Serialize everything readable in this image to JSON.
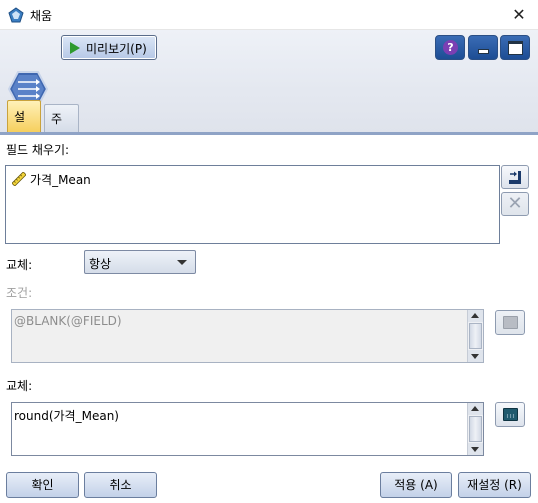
{
  "window": {
    "title": "채움",
    "close_glyph": "✕"
  },
  "toolbar": {
    "preview_label": "미리보기(P)",
    "help_glyph": "?",
    "icons": [
      "filler-node-icon",
      "play-icon",
      "help-icon",
      "minimize-icon",
      "maximize-icon"
    ]
  },
  "tabs": [
    {
      "label": "설정",
      "active": true
    },
    {
      "label": "주석",
      "active": false
    }
  ],
  "settings": {
    "fill_fields_label": "필드 채우기:",
    "fields": [
      "가격_Mean"
    ],
    "replace_mode_label": "교체:",
    "replace_mode_value": "항상",
    "condition_label": "조건:",
    "condition_value": "@BLANK(@FIELD)",
    "replace_with_label": "교체:",
    "replace_with_value": "round(가격_Mean)"
  },
  "buttons": {
    "ok": "확인",
    "cancel": "취소",
    "apply": "적용 (A)",
    "reset": "재설정 (R)"
  },
  "colors": {
    "accent": "#8fa3c6",
    "active_tab": "#f6cf5e",
    "help": "#7b3fb3",
    "toolbar_button": "#1d4d94"
  }
}
